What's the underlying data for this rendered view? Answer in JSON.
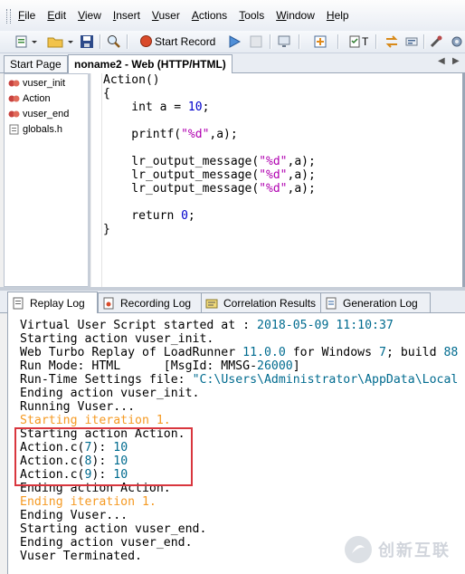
{
  "menu": {
    "items": [
      "File",
      "Edit",
      "View",
      "Insert",
      "Vuser",
      "Actions",
      "Tools",
      "Window",
      "Help"
    ]
  },
  "toolbar": {
    "start_record_label": "Start Record",
    "t_label": "T"
  },
  "tabs": [
    {
      "label": "Start Page"
    },
    {
      "label": "noname2 - Web (HTTP/HTML)"
    }
  ],
  "tree": {
    "items": [
      "vuser_init",
      "Action",
      "vuser_end",
      "globals.h"
    ]
  },
  "code": {
    "lines": [
      [
        {
          "t": "Action()",
          "c": ""
        }
      ],
      [
        {
          "t": "{",
          "c": ""
        }
      ],
      [
        {
          "t": "    int a = ",
          "c": ""
        },
        {
          "t": "10",
          "c": "n"
        },
        {
          "t": ";",
          "c": ""
        }
      ],
      [
        {
          "t": "",
          "c": ""
        }
      ],
      [
        {
          "t": "    printf(",
          "c": ""
        },
        {
          "t": "\"%d\"",
          "c": "s"
        },
        {
          "t": ",a);",
          "c": ""
        }
      ],
      [
        {
          "t": "",
          "c": ""
        }
      ],
      [
        {
          "t": "    lr_output_message(",
          "c": ""
        },
        {
          "t": "\"%d\"",
          "c": "s"
        },
        {
          "t": ",a);",
          "c": ""
        }
      ],
      [
        {
          "t": "    lr_output_message(",
          "c": ""
        },
        {
          "t": "\"%d\"",
          "c": "s"
        },
        {
          "t": ",a);",
          "c": ""
        }
      ],
      [
        {
          "t": "    lr_output_message(",
          "c": ""
        },
        {
          "t": "\"%d\"",
          "c": "s"
        },
        {
          "t": ",a);",
          "c": ""
        }
      ],
      [
        {
          "t": "",
          "c": ""
        }
      ],
      [
        {
          "t": "    return ",
          "c": ""
        },
        {
          "t": "0",
          "c": "n"
        },
        {
          "t": ";",
          "c": ""
        }
      ],
      [
        {
          "t": "}",
          "c": ""
        }
      ]
    ]
  },
  "output_tabs": [
    {
      "label": "Replay Log"
    },
    {
      "label": "Recording Log"
    },
    {
      "label": "Correlation Results"
    },
    {
      "label": "Generation Log"
    }
  ],
  "log": {
    "lines": [
      [
        {
          "t": "Virtual User Script started at : ",
          "c": ""
        },
        {
          "t": "2018-05-09 11:10:37",
          "c": "teal"
        }
      ],
      [
        {
          "t": "Starting action vuser_init.",
          "c": ""
        }
      ],
      [
        {
          "t": "Web Turbo Replay of LoadRunner ",
          "c": ""
        },
        {
          "t": "11.0.0",
          "c": "teal"
        },
        {
          "t": " for Windows ",
          "c": ""
        },
        {
          "t": "7",
          "c": "teal"
        },
        {
          "t": "; build ",
          "c": ""
        },
        {
          "t": "88",
          "c": "teal"
        }
      ],
      [
        {
          "t": "Run Mode: HTML      [MsgId: MMSG-",
          "c": ""
        },
        {
          "t": "26000",
          "c": "teal"
        },
        {
          "t": "]",
          "c": ""
        }
      ],
      [
        {
          "t": "Run-Time Settings file: ",
          "c": ""
        },
        {
          "t": "\"C:\\Users\\Administrator\\AppData\\Local",
          "c": "teal"
        }
      ],
      [
        {
          "t": "Ending action vuser_init.",
          "c": ""
        }
      ],
      [
        {
          "t": "Running Vuser...",
          "c": ""
        }
      ],
      [
        {
          "t": "Starting iteration 1.",
          "c": "orange"
        }
      ],
      [
        {
          "t": "Starting action Action.",
          "c": ""
        }
      ],
      [
        {
          "t": "Action.c(",
          "c": ""
        },
        {
          "t": "7",
          "c": "teal"
        },
        {
          "t": "): ",
          "c": ""
        },
        {
          "t": "10",
          "c": "teal"
        }
      ],
      [
        {
          "t": "Action.c(",
          "c": ""
        },
        {
          "t": "8",
          "c": "teal"
        },
        {
          "t": "): ",
          "c": ""
        },
        {
          "t": "10",
          "c": "teal"
        }
      ],
      [
        {
          "t": "Action.c(",
          "c": ""
        },
        {
          "t": "9",
          "c": "teal"
        },
        {
          "t": "): ",
          "c": ""
        },
        {
          "t": "10",
          "c": "teal"
        }
      ],
      [
        {
          "t": "Ending action Action.",
          "c": ""
        }
      ],
      [
        {
          "t": "Ending iteration 1.",
          "c": "orange"
        }
      ],
      [
        {
          "t": "Ending Vuser...",
          "c": ""
        }
      ],
      [
        {
          "t": "Starting action vuser_end.",
          "c": ""
        }
      ],
      [
        {
          "t": "Ending action vuser_end.",
          "c": ""
        }
      ],
      [
        {
          "t": "Vuser Terminated.",
          "c": ""
        }
      ]
    ]
  },
  "watermark": {
    "text": "创新互联"
  },
  "colors": {
    "highlight_box": "#d9363e",
    "number": "#0000cc",
    "string": "#b000b0",
    "iteration": "#f59a23"
  }
}
